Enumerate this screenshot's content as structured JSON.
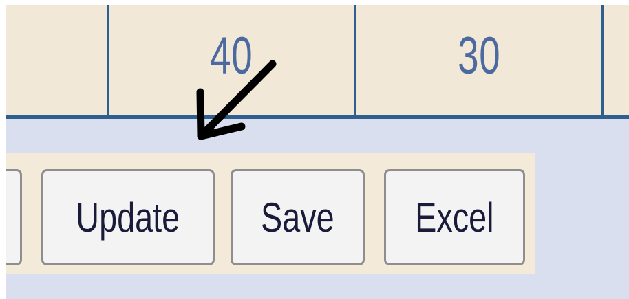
{
  "grid": {
    "cells": [
      "40",
      "30"
    ]
  },
  "toolbar": {
    "update_label": "Update",
    "save_label": "Save",
    "excel_label": "Excel"
  },
  "annotation": {
    "icon": "arrow-down-left-icon",
    "color": "#000000"
  },
  "colors": {
    "grid_background": "#f2e8d8",
    "grid_border": "#2e5f8e",
    "cell_text": "#4c6aa0",
    "page_background": "#d9dfee",
    "button_bar_background": "#f3ead9",
    "button_background": "#f3f3f3",
    "button_border": "#8e8e8e"
  }
}
